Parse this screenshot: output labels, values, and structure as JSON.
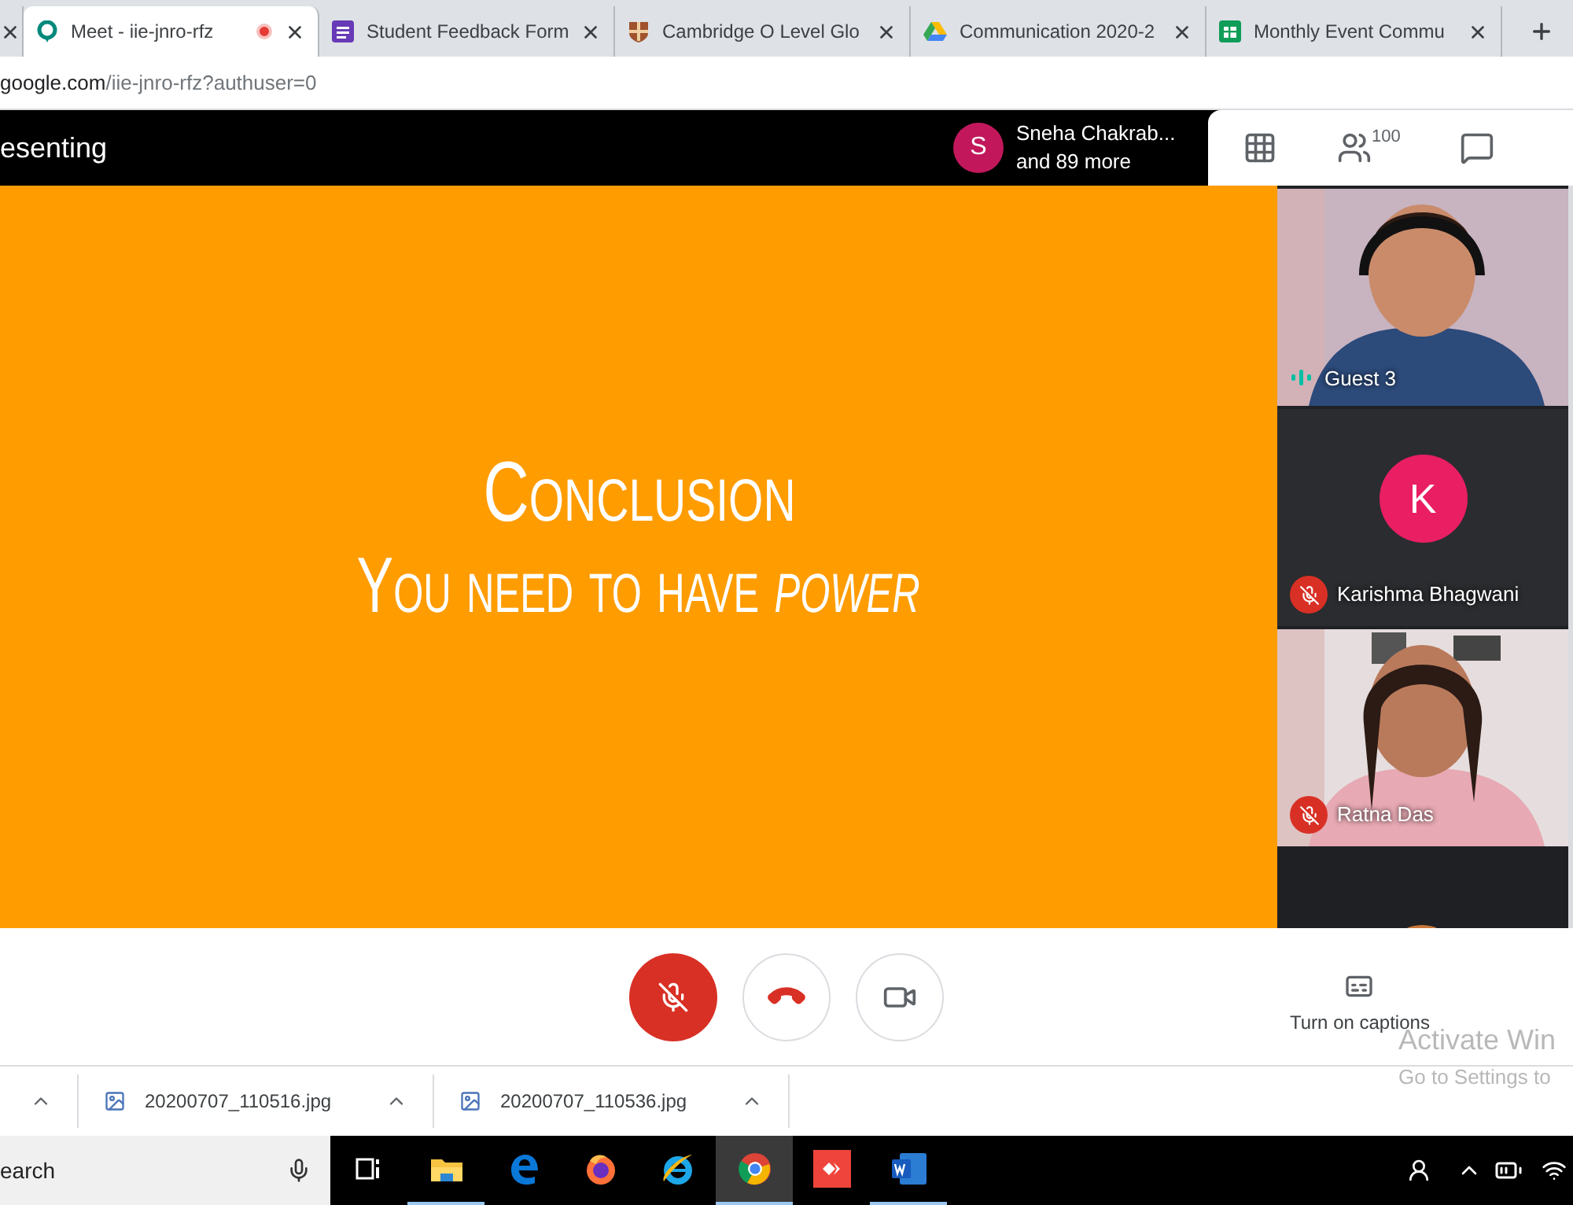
{
  "tabs": [
    {
      "kind": "cut",
      "selected": false,
      "recording": false
    },
    {
      "kind": "meet",
      "title": "Meet - iie-jnro-rfz",
      "selected": true,
      "recording": true
    },
    {
      "kind": "form",
      "title": "Student Feedback Form",
      "selected": false,
      "recording": false
    },
    {
      "kind": "crest",
      "title": "Cambridge O Level Glo",
      "selected": false,
      "recording": false
    },
    {
      "kind": "drive",
      "title": "Communication 2020-2",
      "selected": false,
      "recording": false
    },
    {
      "kind": "sheets",
      "title": "Monthly Event Commu",
      "selected": false,
      "recording": false
    }
  ],
  "address": {
    "host": "google.com",
    "path": "/iie-jnro-rfz?authuser=0"
  },
  "meet_bar": {
    "title": "esenting",
    "presenter": {
      "initial": "S",
      "color": "#c2185b",
      "name": "Sneha Chakrab...",
      "more": "and 89 more"
    },
    "people_count": "100"
  },
  "slide": {
    "heading": "Conclusion",
    "line": "You need to have *power*"
  },
  "tiles": [
    {
      "kind": "video",
      "name": "Guest 3",
      "muted": false,
      "speaking": true
    },
    {
      "kind": "avatar",
      "initial": "K",
      "color": "#e91e63",
      "name": "Karishma Bhagwani",
      "muted": true,
      "speaking": false
    },
    {
      "kind": "video",
      "name": "Ratna Das",
      "muted": true,
      "speaking": false
    },
    {
      "kind": "video",
      "muted": false,
      "speaking": false
    }
  ],
  "controls": {
    "mic_muted": true,
    "captions": "Turn on captions"
  },
  "activation": {
    "title": "Activate Win",
    "subtitle": "Go to Settings to"
  },
  "downloads": [
    {
      "kind": "cut"
    },
    {
      "kind": "file",
      "name": "20200707_110516.jpg"
    },
    {
      "kind": "file",
      "name": "20200707_110536.jpg"
    }
  ],
  "taskbar": {
    "search": "earch",
    "apps": [
      {
        "kind": "taskview",
        "active": false
      },
      {
        "kind": "folder",
        "active": true
      },
      {
        "kind": "edge",
        "active": false
      },
      {
        "kind": "firefox",
        "active": false
      },
      {
        "kind": "ie",
        "active": false
      },
      {
        "kind": "chrome",
        "active": true
      },
      {
        "kind": "remote",
        "active": false
      },
      {
        "kind": "word",
        "active": true
      }
    ]
  }
}
